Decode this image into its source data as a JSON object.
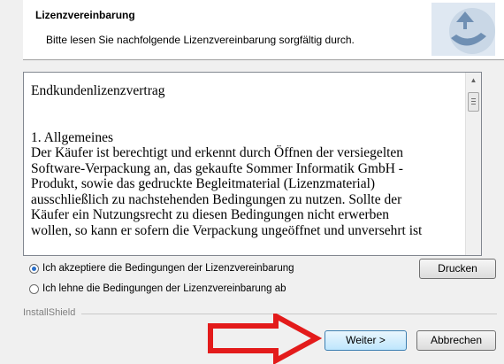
{
  "header": {
    "title": "Lizenzvereinbarung",
    "subtitle": "Bitte lesen Sie nachfolgende Lizenzvereinbarung sorgfältig durch."
  },
  "license": {
    "heading": "Endkundenlizenzvertrag",
    "section_title": "1. Allgemeines",
    "lines": [
      "Der Käufer ist berechtigt und erkennt durch Öffnen der versiegelten",
      "Software-Verpackung an, das gekaufte Sommer Informatik GmbH -",
      "Produkt, sowie das gedruckte Begleitmaterial (Lizenzmaterial)",
      "ausschließlich zu nachstehenden Bedingungen zu nutzen. Sollte der",
      "Käufer ein Nutzungsrecht zu diesen Bedingungen nicht erwerben",
      "wollen, so kann er sofern die Verpackung ungeöffnet und unversehrt ist"
    ]
  },
  "options": {
    "accept": "Ich akzeptiere die Bedingungen der Lizenzvereinbarung",
    "decline": "Ich lehne die Bedingungen der Lizenzvereinbarung ab",
    "selected": "accept"
  },
  "buttons": {
    "print": "Drucken",
    "next": "Weiter >",
    "cancel": "Abbrechen"
  },
  "footer": {
    "brand": "InstallShield"
  },
  "colors": {
    "annotation_arrow": "#e31b1b",
    "logo": "#6f8fb3"
  },
  "icons": [
    "installshield-logo-icon",
    "scroll-up-icon",
    "red-arrow-annotation"
  ]
}
